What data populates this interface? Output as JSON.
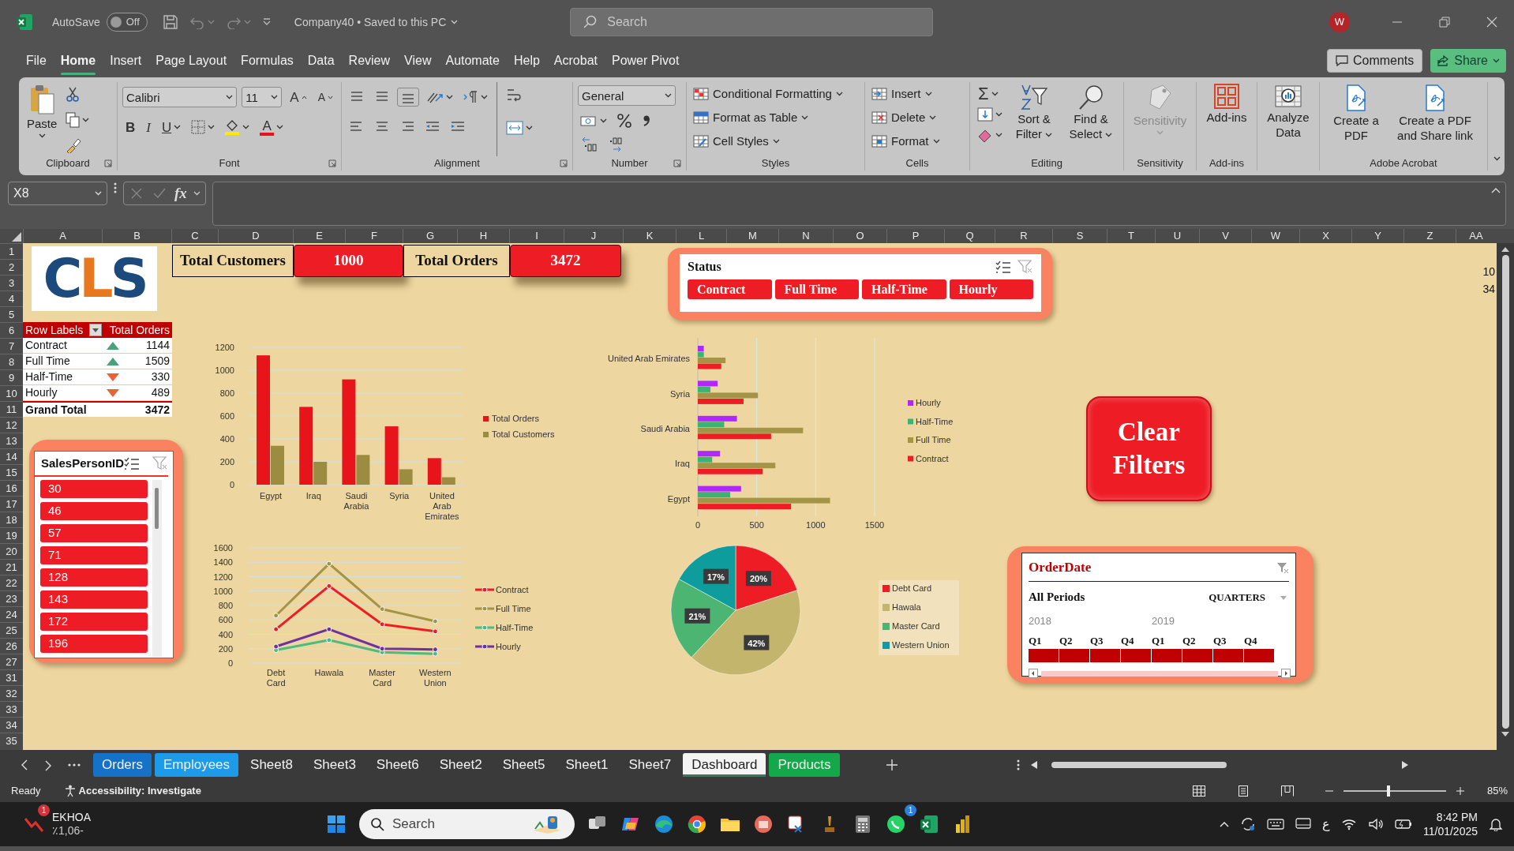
{
  "title_bar": {
    "autosave_label": "AutoSave",
    "autosave": {
      "on": false,
      "label": "Off"
    },
    "document": "Company40 • Saved to this PC",
    "search_placeholder": "Search",
    "avatar": "W"
  },
  "menu": {
    "tabs": [
      {
        "label": "File",
        "selected": false
      },
      {
        "label": "Home",
        "selected": true
      },
      {
        "label": "Insert",
        "selected": false
      },
      {
        "label": "Page Layout",
        "selected": false
      },
      {
        "label": "Formulas",
        "selected": false
      },
      {
        "label": "Data",
        "selected": false
      },
      {
        "label": "Review",
        "selected": false
      },
      {
        "label": "View",
        "selected": false
      },
      {
        "label": "Automate",
        "selected": false
      },
      {
        "label": "Help",
        "selected": false
      },
      {
        "label": "Acrobat",
        "selected": false
      },
      {
        "label": "Power Pivot",
        "selected": false
      }
    ],
    "comments": "Comments",
    "share": "Share"
  },
  "ribbon": {
    "groups": [
      {
        "kind": "clipboard",
        "label": "Clipboard",
        "paste": "Paste"
      },
      {
        "kind": "font",
        "label": "Font",
        "font_name": "Calibri",
        "font_size": "11",
        "grow": "A",
        "shrink": "A",
        "bold": "B",
        "italic": "I",
        "underline": "U",
        "font_color": "A"
      },
      {
        "kind": "alignment",
        "label": "Alignment"
      },
      {
        "kind": "number",
        "label": "Number",
        "format": "General"
      },
      {
        "kind": "list",
        "label": "Styles",
        "items": [
          "Conditional Formatting",
          "Format as Table",
          "Cell Styles"
        ]
      },
      {
        "kind": "list",
        "label": "Cells",
        "items": [
          "Insert",
          "Delete",
          "Format"
        ]
      },
      {
        "kind": "editing",
        "label": "Editing",
        "sum": "Σ",
        "items": [
          "Sort & Filter",
          "Find & Select"
        ]
      },
      {
        "kind": "large",
        "label": "Sensitivity",
        "items": [
          {
            "label": "Sensitivity",
            "disabled": true
          }
        ]
      },
      {
        "kind": "large",
        "label": "Add-ins",
        "items": [
          {
            "label": "Add-ins",
            "disabled": false
          }
        ]
      },
      {
        "kind": "large",
        "items": [
          {
            "label": "Analyze Data",
            "disabled": false
          }
        ]
      },
      {
        "kind": "large",
        "label": "Adobe Acrobat",
        "items": [
          {
            "label": "Create a PDF",
            "disabled": false
          },
          {
            "label": "Create a PDF and Share link",
            "disabled": false
          }
        ]
      }
    ]
  },
  "formula_bar": {
    "name_box": "X8",
    "fx": "fx"
  },
  "sheet": {
    "columns": [
      "A",
      "B",
      "C",
      "D",
      "E",
      "F",
      "G",
      "H",
      "I",
      "J",
      "K",
      "L",
      "M",
      "N",
      "O",
      "P",
      "Q",
      "R",
      "S",
      "T",
      "U",
      "V",
      "W",
      "X",
      "Y",
      "Z",
      "AA"
    ],
    "rows": [
      "1",
      "2",
      "3",
      "4",
      "5",
      "6",
      "7",
      "8",
      "9",
      "10",
      "11",
      "12",
      "13",
      "14",
      "15",
      "16",
      "17",
      "18",
      "19",
      "20",
      "21",
      "22",
      "23",
      "24",
      "25",
      "26",
      "27",
      "31",
      "32",
      "33",
      "34",
      "35"
    ],
    "edge_cells": [
      "10",
      "34"
    ]
  },
  "logo": {
    "letters": [
      {
        "text": "C",
        "color": "#1d4a7c"
      },
      {
        "text": "L",
        "color": "#e8781e"
      },
      {
        "text": "S",
        "color": "#1d4a7c"
      }
    ]
  },
  "kpis": [
    {
      "label": "Total Customers",
      "value": "1000"
    },
    {
      "label": "Total Orders",
      "value": "3472"
    }
  ],
  "pivot": {
    "columns": [
      "Row Labels",
      "Total Orders"
    ],
    "rows": [
      {
        "label": "Contract",
        "kind": "up",
        "value": "1144"
      },
      {
        "label": "Full Time",
        "kind": "up",
        "value": "1509"
      },
      {
        "label": "Half-Time",
        "kind": "down",
        "value": "330"
      },
      {
        "label": "Hourly",
        "kind": "down",
        "value": "489"
      }
    ],
    "total": {
      "label": "Grand Total",
      "value": "3472"
    }
  },
  "salesperson_slicer": {
    "title": "SalesPersonID",
    "items": [
      {
        "label": "30",
        "selected": true
      },
      {
        "label": "46",
        "selected": true
      },
      {
        "label": "57",
        "selected": true
      },
      {
        "label": "71",
        "selected": true
      },
      {
        "label": "128",
        "selected": true
      },
      {
        "label": "143",
        "selected": true
      },
      {
        "label": "172",
        "selected": true
      },
      {
        "label": "196",
        "selected": true
      }
    ]
  },
  "status_slicer": {
    "title": "Status",
    "items": [
      {
        "label": "Contract",
        "selected": true
      },
      {
        "label": "Full Time",
        "selected": true
      },
      {
        "label": "Half-Time",
        "selected": true
      },
      {
        "label": "Hourly",
        "selected": true
      }
    ]
  },
  "country_chart": {
    "chart_data": {
      "type": "bar",
      "categories": [
        "Egypt",
        "Iraq",
        "Saudi Arabia",
        "Syria",
        "United Arab Emirates"
      ],
      "series": [
        {
          "name": "Total Orders",
          "color": "#e8141c",
          "values": [
            1130,
            680,
            920,
            510,
            232
          ]
        },
        {
          "name": "Total Customers",
          "color": "#9c8c40",
          "values": [
            340,
            200,
            260,
            135,
            65
          ]
        }
      ],
      "ylim": [
        0,
        1200
      ],
      "yticks": [
        0,
        200,
        400,
        600,
        800,
        1000,
        1200
      ],
      "grid": true,
      "legend": "right"
    }
  },
  "payment_line_chart": {
    "chart_data": {
      "type": "line",
      "categories": [
        "Debt Card",
        "Hawala",
        "Master Card",
        "Western Union"
      ],
      "series": [
        {
          "name": "Contract",
          "color": "#ee1c25",
          "values": [
            470,
            1070,
            540,
            440
          ],
          "marker": "circle"
        },
        {
          "name": "Full Time",
          "color": "#a39545",
          "values": [
            660,
            1380,
            750,
            580
          ],
          "marker": "circle"
        },
        {
          "name": "Half-Time",
          "color": "#4cbb7f",
          "values": [
            180,
            320,
            150,
            130
          ],
          "marker": "circle"
        },
        {
          "name": "Hourly",
          "color": "#7030a0",
          "values": [
            230,
            470,
            200,
            190
          ],
          "marker": "circle"
        }
      ],
      "ylim": [
        0,
        1600
      ],
      "yticks": [
        0,
        200,
        400,
        600,
        800,
        1000,
        1200,
        1400,
        1600
      ],
      "grid": true,
      "legend": "right"
    }
  },
  "status_country_chart": {
    "chart_data": {
      "type": "bar",
      "orientation": "horizontal",
      "categories": [
        "United Arab Emirates",
        "Syria",
        "Saudi Arabia",
        "Iraq",
        "Egypt"
      ],
      "series": [
        {
          "name": "Contract",
          "color": "#ee1c25",
          "values": [
            199,
            388,
            622,
            551,
            791
          ]
        },
        {
          "name": "Full Time",
          "color": "#a39545",
          "values": [
            235,
            510,
            893,
            658,
            1122
          ]
        },
        {
          "name": "Half-Time",
          "color": "#3cb371",
          "values": [
            51,
            107,
            224,
            122,
            275
          ]
        },
        {
          "name": "Hourly",
          "color": "#b026ff",
          "values": [
            51,
            168,
            332,
            189,
            367
          ]
        }
      ],
      "xlim": [
        0,
        1500
      ],
      "xticks": [
        0,
        500,
        1000,
        1500
      ],
      "grid": true,
      "legend": "right"
    }
  },
  "clear_filters": "Clear Filters",
  "payment_pie": {
    "chart_data": {
      "type": "pie",
      "categories": [
        "Debt Card",
        "Hawala",
        "Master Card",
        "Western Union"
      ],
      "values": [
        20,
        42,
        21,
        17
      ],
      "value_labels": [
        "20%",
        "42%",
        "21%",
        "17%"
      ],
      "legend": "right"
    },
    "slices": [
      {
        "color": "#ee1c25"
      },
      {
        "color": "#c4b56c"
      },
      {
        "color": "#4cb572"
      },
      {
        "color": "#0e9c9c"
      }
    ]
  },
  "timeline": {
    "title": "OrderDate",
    "period": "All Periods",
    "unit": "QUARTERS",
    "years": [
      "2018",
      "2019"
    ],
    "quarters": [
      {
        "label": "Q1",
        "selected": true
      },
      {
        "label": "Q2",
        "selected": true
      },
      {
        "label": "Q3",
        "selected": true
      },
      {
        "label": "Q4",
        "selected": true
      },
      {
        "label": "Q1",
        "selected": true
      },
      {
        "label": "Q2",
        "selected": true
      },
      {
        "label": "Q3",
        "selected": true
      },
      {
        "label": "Q4",
        "selected": true
      }
    ]
  },
  "sheet_tabs": [
    {
      "label": "Orders",
      "selected": false,
      "color": "#1572c6"
    },
    {
      "label": "Employees",
      "selected": false,
      "color": "#1e9be8"
    },
    {
      "label": "Sheet8",
      "selected": false
    },
    {
      "label": "Sheet3",
      "selected": false
    },
    {
      "label": "Sheet6",
      "selected": false
    },
    {
      "label": "Sheet2",
      "selected": false
    },
    {
      "label": "Sheet5",
      "selected": false
    },
    {
      "label": "Sheet1",
      "selected": false
    },
    {
      "label": "Sheet7",
      "selected": false
    },
    {
      "label": "Dashboard",
      "selected": true
    },
    {
      "label": "Products",
      "selected": false,
      "color": "#15a84a"
    }
  ],
  "status_bar": {
    "ready": "Ready",
    "accessibility": "Accessibility: Investigate",
    "zoom_slider": {
      "level": 0.42
    },
    "zoom": "85%"
  },
  "taskbar": {
    "ticker": {
      "symbol": "EKHOA",
      "change": "٪1,06-",
      "badge": "1"
    },
    "search_placeholder": "Search",
    "chat_badge": "1",
    "language": "ع",
    "time": "8:42 PM",
    "date": "11/01/2025"
  }
}
